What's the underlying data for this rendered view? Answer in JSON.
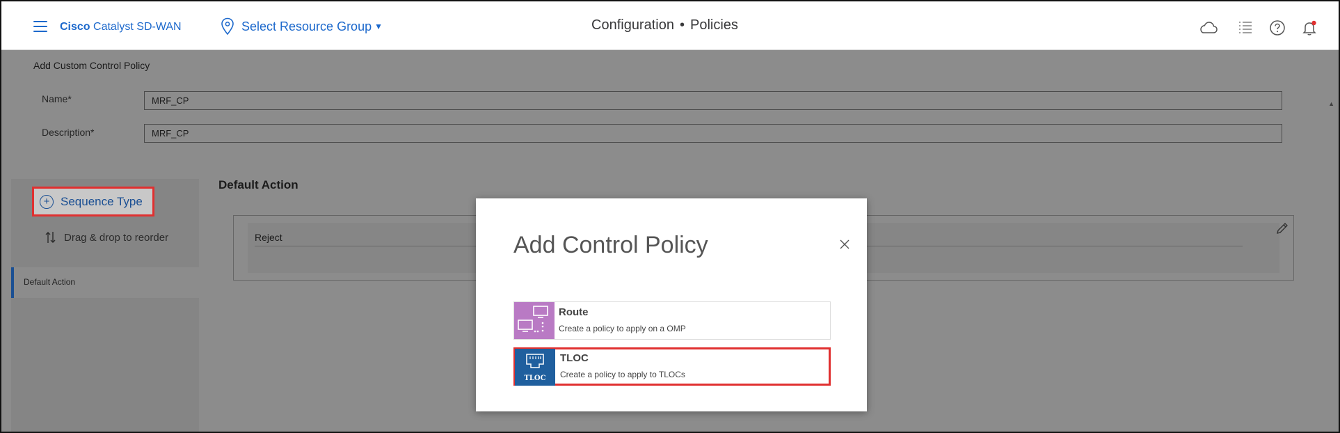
{
  "header": {
    "brand_bold": "Cisco",
    "brand_rest": "Catalyst SD-WAN",
    "resource_group": "Select Resource Group",
    "section": "Configuration",
    "page": "Policies"
  },
  "form": {
    "title": "Add Custom Control Policy",
    "name_label": "Name*",
    "name_value": "MRF_CP",
    "description_label": "Description*",
    "description_value": "MRF_CP"
  },
  "left_panel": {
    "sequence_type_label": "Sequence Type",
    "drag_label": "Drag & drop to reorder",
    "items": [
      {
        "label": "Default Action"
      }
    ]
  },
  "main": {
    "default_action_title": "Default Action",
    "action_value": "Reject"
  },
  "modal": {
    "title": "Add Control Policy",
    "options": [
      {
        "name": "Route",
        "description": "Create a policy to apply on a OMP",
        "icon": "route-icon",
        "color": "#b97ac4"
      },
      {
        "name": "TLOC",
        "description": "Create a policy to apply to TLOCs",
        "icon": "tloc-icon",
        "icon_text": "TLOC",
        "color": "#1f5f9e",
        "selected": true
      }
    ]
  },
  "colors": {
    "accent": "#1d69cc",
    "highlight": "#e03030",
    "notification": "#e03030"
  }
}
